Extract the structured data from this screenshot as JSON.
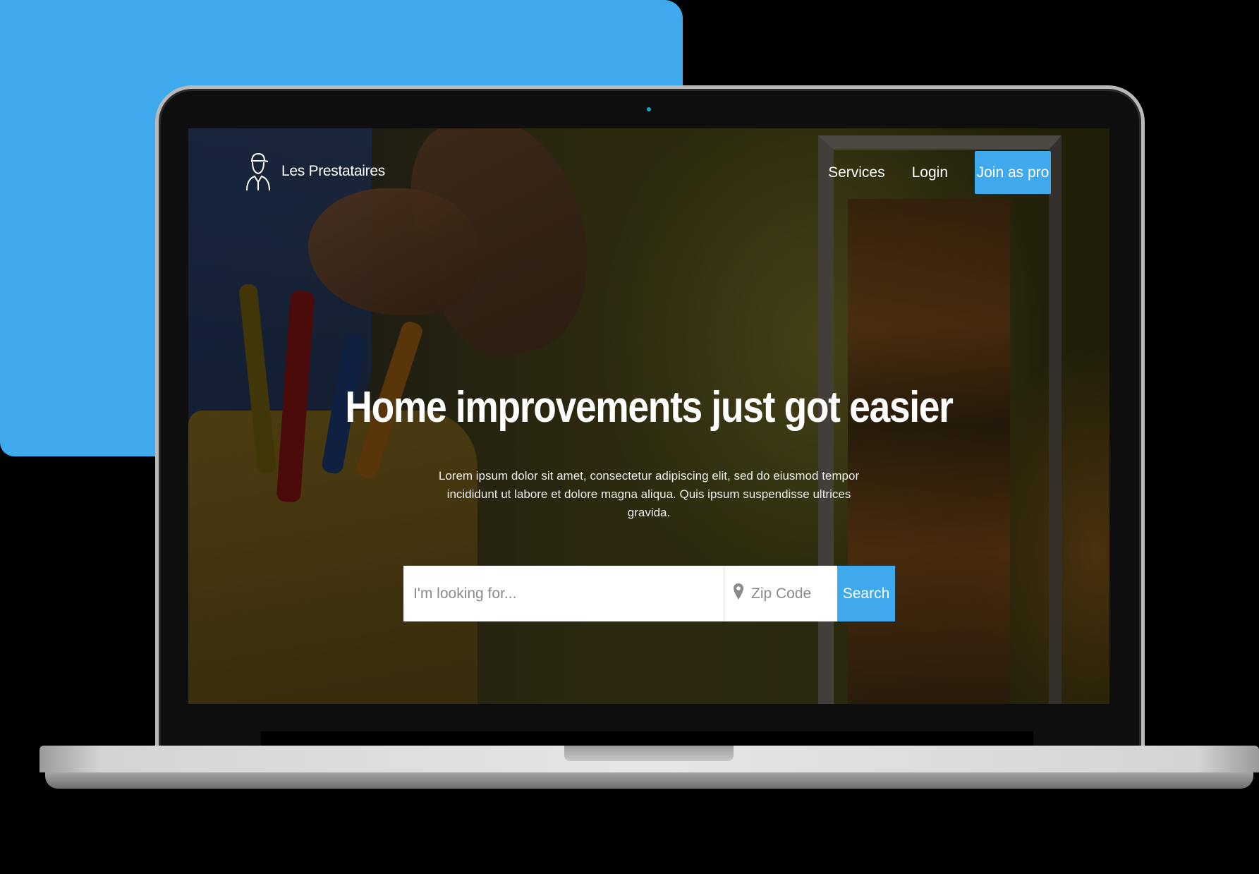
{
  "brand": {
    "name": "Les Prestataires",
    "logo_icon": "worker-icon"
  },
  "nav": {
    "links": [
      "Services",
      "Login"
    ],
    "cta_label": "Join as pro"
  },
  "hero": {
    "title": "Home improvements just got easier",
    "subtitle": "Lorem ipsum dolor sit amet, consectetur adipiscing elit, sed do eiusmod tempor incididunt ut labore et dolore magna aliqua. Quis ipsum suspendisse ultrices gravida."
  },
  "search": {
    "query_placeholder": "I'm looking for...",
    "zip_placeholder": "Zip Code",
    "zip_icon": "location-pin-icon",
    "button_label": "Search"
  },
  "colors": {
    "accent": "#3fa9ee",
    "text": "#ffffff"
  }
}
